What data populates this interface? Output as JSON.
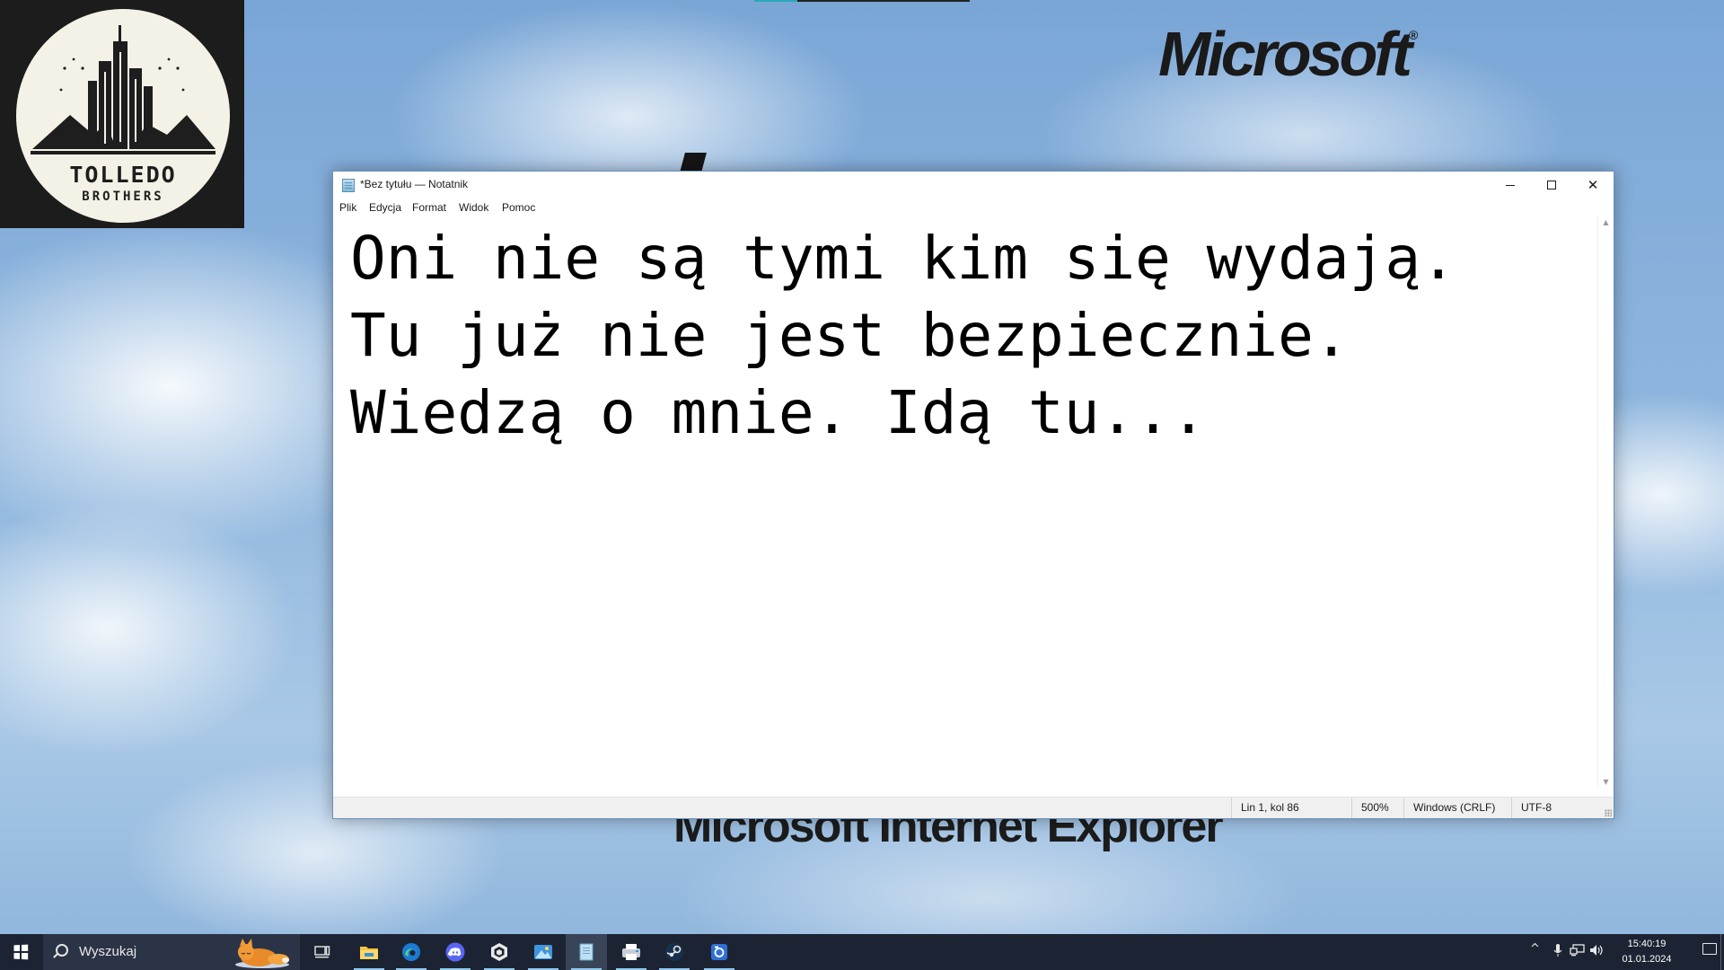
{
  "desktop": {
    "logo": {
      "name": "Tolledo Brothers",
      "line1": "TOLLEDO",
      "line2": "BROTHERS",
      "icon": "city-skyline-logo"
    },
    "wallpaper_brand": "Microsoft",
    "wallpaper_caption": "Microsoft Internet Explorer"
  },
  "notepad": {
    "title": "*Bez tytułu — Notatnik",
    "controls": {
      "minimize_icon": "minimize-icon",
      "maximize_icon": "maximize-icon",
      "close_icon": "close-icon",
      "close_glyph": "✕"
    },
    "menu": [
      "Plik",
      "Edycja",
      "Format",
      "Widok",
      "Pomoc"
    ],
    "content": {
      "lines": [
        "Oni nie są tymi kim się wydają.",
        "Tu już nie jest bezpiecznie.",
        "Wiedzą o mnie. Idą tu..."
      ]
    },
    "status": {
      "position": "Lin 1, kol 86",
      "zoom": "500%",
      "line_endings": "Windows (CRLF)",
      "encoding": "UTF-8"
    }
  },
  "taskbar": {
    "search_placeholder": "Wyszukaj",
    "apps": [
      {
        "name": "file-explorer-icon",
        "active": true
      },
      {
        "name": "edge-icon",
        "active": true
      },
      {
        "name": "discord-icon",
        "active": true
      },
      {
        "name": "unity-icon",
        "active": true
      },
      {
        "name": "paint-icon",
        "active": true
      },
      {
        "name": "notepad-icon",
        "active": true,
        "focused": true
      },
      {
        "name": "printer-app-icon",
        "active": true
      },
      {
        "name": "steam-icon",
        "active": true
      },
      {
        "name": "capture-app-icon",
        "active": true
      }
    ],
    "tray": {
      "chevron_glyph": "^",
      "time": "15:40:19",
      "date": "01.01.2024"
    }
  }
}
